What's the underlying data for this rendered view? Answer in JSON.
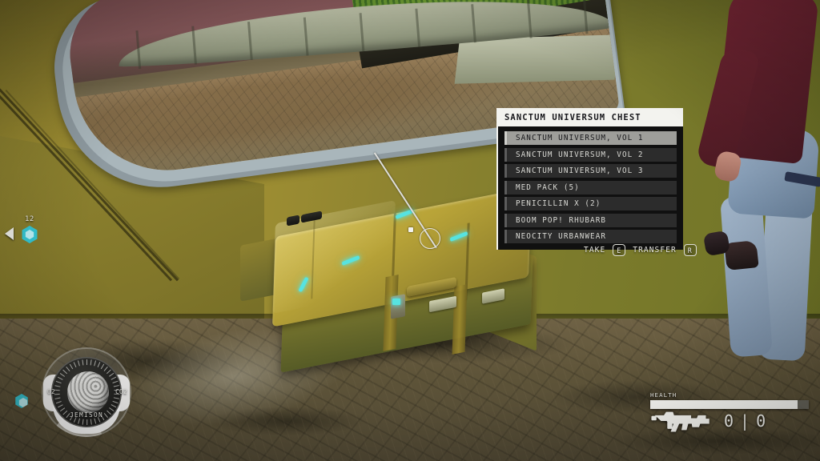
{
  "hud": {
    "crosshair": {
      "icon": "crosshair-dot"
    },
    "oxygen_pip": {
      "count": "12",
      "arrow_icon": "left-triangle-icon",
      "marker_icon": "hex-marker-icon"
    },
    "compass": {
      "left_label": "O2",
      "right_label": "CO2",
      "planet_name": "JEMISON",
      "planet_icon": "planet-dial-icon"
    },
    "status": {
      "health_label": "HEALTH",
      "health_percent": 93,
      "weapon_icon": "rifle-icon",
      "ammo_current": "0",
      "ammo_separator": "|",
      "ammo_reserve": "0"
    },
    "floor_marker_icon": "hex-marker-icon"
  },
  "container_panel": {
    "title": "SANCTUM UNIVERSUM CHEST",
    "selected_index": 0,
    "items": [
      {
        "label": "SANCTUM UNIVERSUM, VOL 1"
      },
      {
        "label": "SANCTUM UNIVERSUM, VOL 2"
      },
      {
        "label": "SANCTUM UNIVERSUM, VOL 3"
      },
      {
        "label": "MED PACK (5)"
      },
      {
        "label": "PENICILLIN X (2)"
      },
      {
        "label": "BOOM POP! RHUBARB"
      },
      {
        "label": "NEOCITY URBANWEAR"
      }
    ]
  },
  "actions": [
    {
      "label": "TAKE",
      "key": "E"
    },
    {
      "label": "TRANSFER",
      "key": "R"
    }
  ],
  "colors": {
    "panel_title_bg": "#f3f3ef",
    "panel_body_bg": "#101010",
    "row_bg": "#2c2c2c",
    "row_selected_bg": "#9e9e9a",
    "accent_cyan": "#57e3e0",
    "hud_white": "#fbfbf7"
  }
}
